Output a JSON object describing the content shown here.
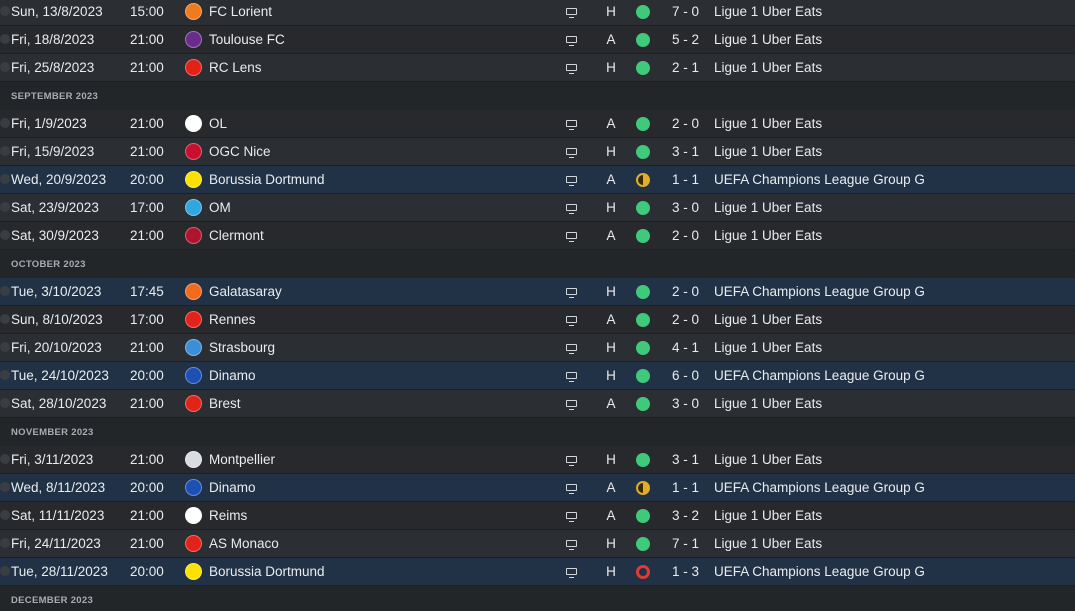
{
  "colors": {
    "background": "#232629",
    "row_odd": "#2b2e32",
    "row_even": "#27292d",
    "row_champions_league": "#223246",
    "win": "#3fc97a",
    "draw": "#e0ad2c",
    "loss": "#e03a35"
  },
  "items": [
    {
      "kind": "match",
      "date": "Sun, 13/8/2023",
      "time": "15:00",
      "team": "FC Lorient",
      "logo_color": "#f07a1e",
      "logo_icon": "lorient-crest-icon",
      "venue": "H",
      "result": "win",
      "score": "7 - 0",
      "competition": "Ligue 1 Uber Eats"
    },
    {
      "kind": "match",
      "date": "Fri, 18/8/2023",
      "time": "21:00",
      "team": "Toulouse FC",
      "logo_color": "#6a2c8c",
      "logo_icon": "toulouse-crest-icon",
      "venue": "A",
      "result": "win",
      "score": "5 - 2",
      "competition": "Ligue 1 Uber Eats"
    },
    {
      "kind": "match",
      "date": "Fri, 25/8/2023",
      "time": "21:00",
      "team": "RC Lens",
      "logo_color": "#e32119",
      "logo_icon": "lens-crest-icon",
      "venue": "H",
      "result": "win",
      "score": "2 - 1",
      "competition": "Ligue 1 Uber Eats"
    },
    {
      "kind": "section",
      "label": "SEPTEMBER 2023"
    },
    {
      "kind": "match",
      "date": "Fri, 1/9/2023",
      "time": "21:00",
      "team": "OL",
      "logo_color": "#ffffff",
      "logo_icon": "ol-crest-icon",
      "venue": "A",
      "result": "win",
      "score": "2 - 0",
      "competition": "Ligue 1 Uber Eats"
    },
    {
      "kind": "match",
      "date": "Fri, 15/9/2023",
      "time": "21:00",
      "team": "OGC Nice",
      "logo_color": "#c8102e",
      "logo_icon": "nice-crest-icon",
      "venue": "H",
      "result": "win",
      "score": "3 - 1",
      "competition": "Ligue 1 Uber Eats"
    },
    {
      "kind": "match",
      "date": "Wed, 20/9/2023",
      "time": "20:00",
      "team": "Borussia Dortmund",
      "logo_color": "#fde100",
      "logo_icon": "dortmund-crest-icon",
      "venue": "A",
      "result": "draw",
      "score": "1 - 1",
      "competition": "UEFA Champions League Group G",
      "highlight": true
    },
    {
      "kind": "match",
      "date": "Sat, 23/9/2023",
      "time": "17:00",
      "team": "OM",
      "logo_color": "#2fa8e0",
      "logo_icon": "om-crest-icon",
      "venue": "H",
      "result": "win",
      "score": "3 - 0",
      "competition": "Ligue 1 Uber Eats"
    },
    {
      "kind": "match",
      "date": "Sat, 30/9/2023",
      "time": "21:00",
      "team": "Clermont",
      "logo_color": "#b0132e",
      "logo_icon": "clermont-crest-icon",
      "venue": "A",
      "result": "win",
      "score": "2 - 0",
      "competition": "Ligue 1 Uber Eats"
    },
    {
      "kind": "section",
      "label": "OCTOBER 2023"
    },
    {
      "kind": "match",
      "date": "Tue, 3/10/2023",
      "time": "17:45",
      "team": "Galatasaray",
      "logo_color": "#f26b1d",
      "logo_icon": "galatasaray-crest-icon",
      "venue": "H",
      "result": "win",
      "score": "2 - 0",
      "competition": "UEFA Champions League Group G",
      "highlight": true
    },
    {
      "kind": "match",
      "date": "Sun, 8/10/2023",
      "time": "17:00",
      "team": "Rennes",
      "logo_color": "#e2231a",
      "logo_icon": "rennes-crest-icon",
      "venue": "A",
      "result": "win",
      "score": "2 - 0",
      "competition": "Ligue 1 Uber Eats"
    },
    {
      "kind": "match",
      "date": "Fri, 20/10/2023",
      "time": "21:00",
      "team": "Strasbourg",
      "logo_color": "#3b8fd6",
      "logo_icon": "strasbourg-crest-icon",
      "venue": "H",
      "result": "win",
      "score": "4 - 1",
      "competition": "Ligue 1 Uber Eats"
    },
    {
      "kind": "match",
      "date": "Tue, 24/10/2023",
      "time": "20:00",
      "team": "Dinamo",
      "logo_color": "#1e4fb3",
      "logo_icon": "dinamo-crest-icon",
      "venue": "H",
      "result": "win",
      "score": "6 - 0",
      "competition": "UEFA Champions League Group G",
      "highlight": true
    },
    {
      "kind": "match",
      "date": "Sat, 28/10/2023",
      "time": "21:00",
      "team": "Brest",
      "logo_color": "#e2231a",
      "logo_icon": "brest-crest-icon",
      "venue": "A",
      "result": "win",
      "score": "3 - 0",
      "competition": "Ligue 1 Uber Eats"
    },
    {
      "kind": "section",
      "label": "NOVEMBER 2023"
    },
    {
      "kind": "match",
      "date": "Fri, 3/11/2023",
      "time": "21:00",
      "team": "Montpellier",
      "logo_color": "#d9dde2",
      "logo_icon": "montpellier-crest-icon",
      "venue": "H",
      "result": "win",
      "score": "3 - 1",
      "competition": "Ligue 1 Uber Eats"
    },
    {
      "kind": "match",
      "date": "Wed, 8/11/2023",
      "time": "20:00",
      "team": "Dinamo",
      "logo_color": "#1e4fb3",
      "logo_icon": "dinamo-crest-icon",
      "venue": "A",
      "result": "draw",
      "score": "1 - 1",
      "competition": "UEFA Champions League Group G",
      "highlight": true
    },
    {
      "kind": "match",
      "date": "Sat, 11/11/2023",
      "time": "21:00",
      "team": "Reims",
      "logo_color": "#ffffff",
      "logo_icon": "reims-crest-icon",
      "venue": "A",
      "result": "win",
      "score": "3 - 2",
      "competition": "Ligue 1 Uber Eats"
    },
    {
      "kind": "match",
      "date": "Fri, 24/11/2023",
      "time": "21:00",
      "team": "AS Monaco",
      "logo_color": "#e2231a",
      "logo_icon": "monaco-crest-icon",
      "venue": "H",
      "result": "win",
      "score": "7 - 1",
      "competition": "Ligue 1 Uber Eats"
    },
    {
      "kind": "match",
      "date": "Tue, 28/11/2023",
      "time": "20:00",
      "team": "Borussia Dortmund",
      "logo_color": "#fde100",
      "logo_icon": "dortmund-crest-icon",
      "venue": "H",
      "result": "loss",
      "score": "1 - 3",
      "competition": "UEFA Champions League Group G",
      "highlight": true
    },
    {
      "kind": "section",
      "label": "DECEMBER 2023"
    }
  ]
}
